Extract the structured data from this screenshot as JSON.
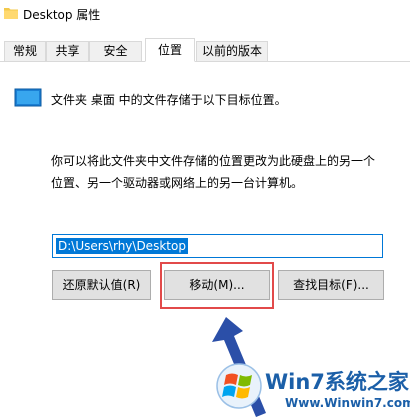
{
  "window": {
    "title": "Desktop 属性"
  },
  "tabs": [
    {
      "label": "常规",
      "active": false
    },
    {
      "label": "共享",
      "active": false
    },
    {
      "label": "安全",
      "active": false
    },
    {
      "label": "位置",
      "active": true
    },
    {
      "label": "以前的版本",
      "active": false
    }
  ],
  "location": {
    "info_text": "文件夹 桌面 中的文件存储于以下目标位置。",
    "description_line1": "你可以将此文件夹中文件存储的位置更改为此硬盘上的另一个",
    "description_line2": "位置、另一个驱动器或网络上的另一台计算机。",
    "path_value": "D:\\Users\\rhy\\Desktop"
  },
  "buttons": {
    "restore_default": "还原默认值(R)",
    "move": "移动(M)...",
    "find_target": "查找目标(F)..."
  },
  "watermark": {
    "brand": "Win7系统之家",
    "url": "Www.Winwin7.com"
  },
  "colors": {
    "accent": "#0078d7",
    "highlight_box": "#e24a4a",
    "arrow": "#2b4fa8",
    "watermark": "#1b5fa8"
  },
  "icons": {
    "title": "folder-icon",
    "info": "desktop-monitor-icon",
    "watermark_logo": "windows-logo-icon"
  }
}
